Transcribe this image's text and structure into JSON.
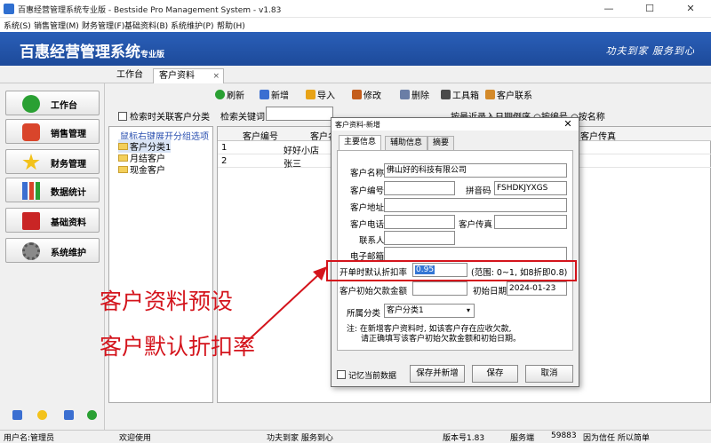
{
  "window": {
    "title": "百惠经营管理系统专业版 - Bestside Pro Management System - v1.83",
    "minimize": "—",
    "maximize": "☐",
    "close": "✕"
  },
  "menu": [
    "系统(S)",
    "销售管理(M)",
    "财务管理(F)",
    "基础资料(B)",
    "系统维护(P)",
    "帮助(H)"
  ],
  "banner": {
    "app_name": "百惠经营管理系统",
    "edition": "专业版",
    "slogan": "功夫到家 服务到心"
  },
  "tabs": [
    "工作台",
    "客户资料"
  ],
  "tab_close": "×",
  "sidebar": [
    {
      "label": "工作台",
      "icon": "check-icon",
      "color": "#2aa033"
    },
    {
      "label": "销售管理",
      "icon": "house-icon",
      "color": "#d9452b"
    },
    {
      "label": "财务管理",
      "icon": "star-icon",
      "color": "#f3c21b"
    },
    {
      "label": "数据统计",
      "icon": "bar-chart-icon",
      "color": "#3b6fd1"
    },
    {
      "label": "基础资料",
      "icon": "book-icon",
      "color": "#c92525"
    },
    {
      "label": "系统维护",
      "icon": "gear-icon",
      "color": "#707070"
    }
  ],
  "toolbar": [
    "刷新",
    "新增",
    "导入",
    "修改",
    "删除",
    "工具箱",
    "客户联系"
  ],
  "search": {
    "link_checkbox": "检索时关联客户分类",
    "keyword_label": "检索关键词",
    "keyword_value": "",
    "sort_label": "按最近录入日期倒序 ○按编号 ○按名称"
  },
  "tree": {
    "hint": "鼠标右键展开分组选项",
    "nodes": [
      "客户分类1",
      "月结客户",
      "现金客户"
    ]
  },
  "grid": {
    "columns": [
      "",
      "客户编号",
      "客户名",
      "客户传真"
    ],
    "rows": [
      {
        "n": "1",
        "code": "",
        "name": "好好小店"
      },
      {
        "n": "2",
        "code": "",
        "name": "张三"
      }
    ]
  },
  "annotation": {
    "line1": "客户资料预设",
    "line2": "客户默认折扣率"
  },
  "dialog": {
    "title": "客户资料-新增",
    "close": "✕",
    "tabs": [
      "主要信息",
      "辅助信息",
      "摘要"
    ],
    "fields": {
      "name_label": "客户名称",
      "name_value": "佛山好的科技有限公司",
      "code_label": "客户编号",
      "code_value": "",
      "pinyin_label": "拼音码",
      "pinyin_value": "FSHDKJYXGS",
      "address_label": "客户地址",
      "address_value": "",
      "phone_label": "客户电话",
      "phone_value": "",
      "fax_label": "客户传真",
      "fax_value": "",
      "contact_label": "联系人",
      "contact_value": "",
      "email_label": "电子邮箱",
      "email_value": "",
      "discount_label": "开单时默认折扣率",
      "discount_value": "0.95",
      "discount_hint": "(范围: 0~1, 如8折即0.8)",
      "arrears_label": "客户初始欠款金额",
      "arrears_value": "",
      "start_date_label": "初始日期",
      "start_date_value": "2024-01-23",
      "category_label": "所属分类",
      "category_value": "客户分类1"
    },
    "note_line1": "注: 在新增客户资料时, 如该客户存在应收欠款,",
    "note_line2": "请正确填写该客户初始欠款金额和初始日期。",
    "remember": "记忆当前数据",
    "buttons": [
      "保存并新增",
      "保存",
      "取消"
    ]
  },
  "status": {
    "user": "用户名:管理员",
    "welcome": "欢迎使用",
    "slogan": "功夫到家 服务到心",
    "version": "版本号1.83",
    "server": "服务端",
    "port": "59883",
    "motto": "因为信任 所以简单"
  }
}
